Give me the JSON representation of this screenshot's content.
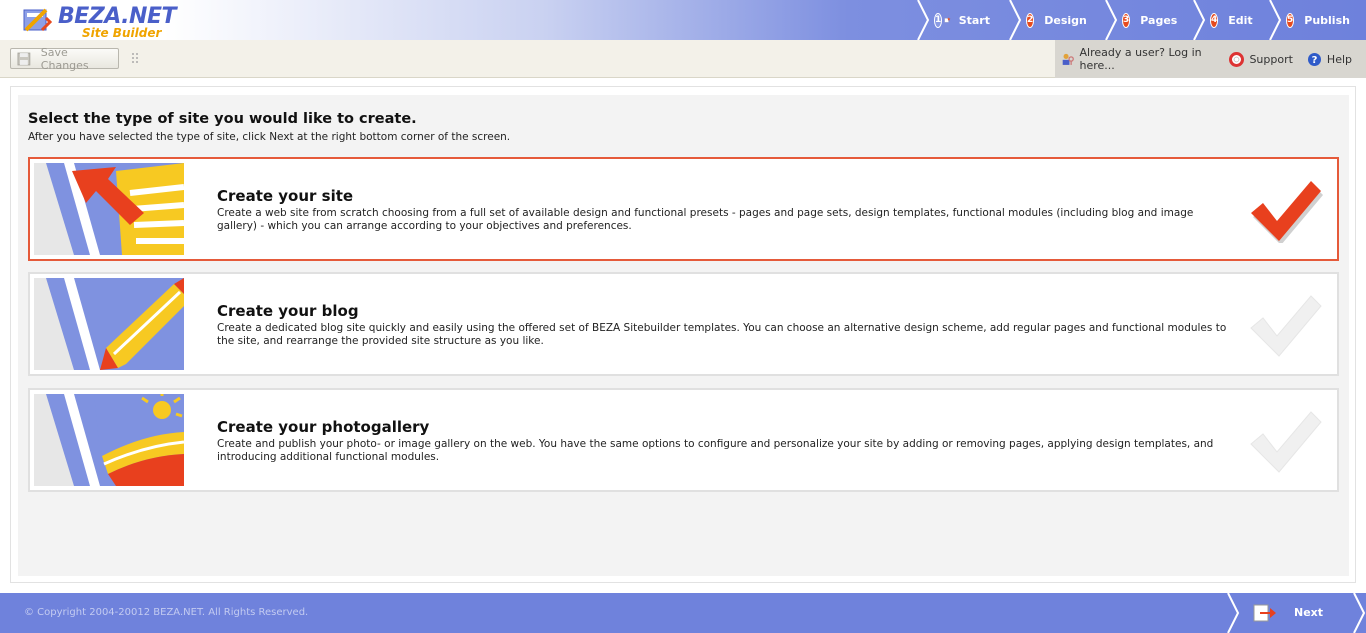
{
  "header": {
    "logo_text": "BEZA.NET",
    "logo_sub": "Site Builder",
    "steps": [
      {
        "num": "1",
        "label": "Start",
        "active": false
      },
      {
        "num": "2",
        "label": "Design",
        "active": true
      },
      {
        "num": "3",
        "label": "Pages",
        "active": true
      },
      {
        "num": "4",
        "label": "Edit",
        "active": true
      },
      {
        "num": "5",
        "label": "Publish",
        "active": true
      }
    ]
  },
  "toolbar": {
    "save_label": "Save Changes",
    "login_label": "Already a user? Log in here...",
    "support_label": "Support",
    "help_label": "Help"
  },
  "main": {
    "title": "Select the type of site you would like to create.",
    "subtitle": "After you have selected the type of site, click Next at the right bottom corner of the screen.",
    "options": [
      {
        "title": "Create your site",
        "description": "Create a web site from scratch choosing from a full set of available design and functional presets - pages and page sets, design templates, functional modules (including blog and image gallery) - which you can arrange according to your objectives and preferences.",
        "selected": true
      },
      {
        "title": "Create your blog",
        "description": "Create a dedicated blog site quickly and easily using the offered set of BEZA Sitebuilder templates. You can choose an alternative design scheme, add regular pages and functional modules to the site, and rearrange the provided site structure as you like.",
        "selected": false
      },
      {
        "title": "Create your photogallery",
        "description": "Create and publish your photo- or image gallery on the web. You have the same options to configure and personalize your site by adding or removing pages, applying design templates, and introducing additional functional modules.",
        "selected": false
      }
    ]
  },
  "footer": {
    "copyright": "© Copyright 2004-20012 BEZA.NET. All Rights Reserved.",
    "next_label": "Next"
  },
  "colors": {
    "header_blue": "#6e81dc",
    "accent_red": "#e64a1f",
    "selected_border": "#e55a3a",
    "footer_blue": "#6f82dc"
  }
}
